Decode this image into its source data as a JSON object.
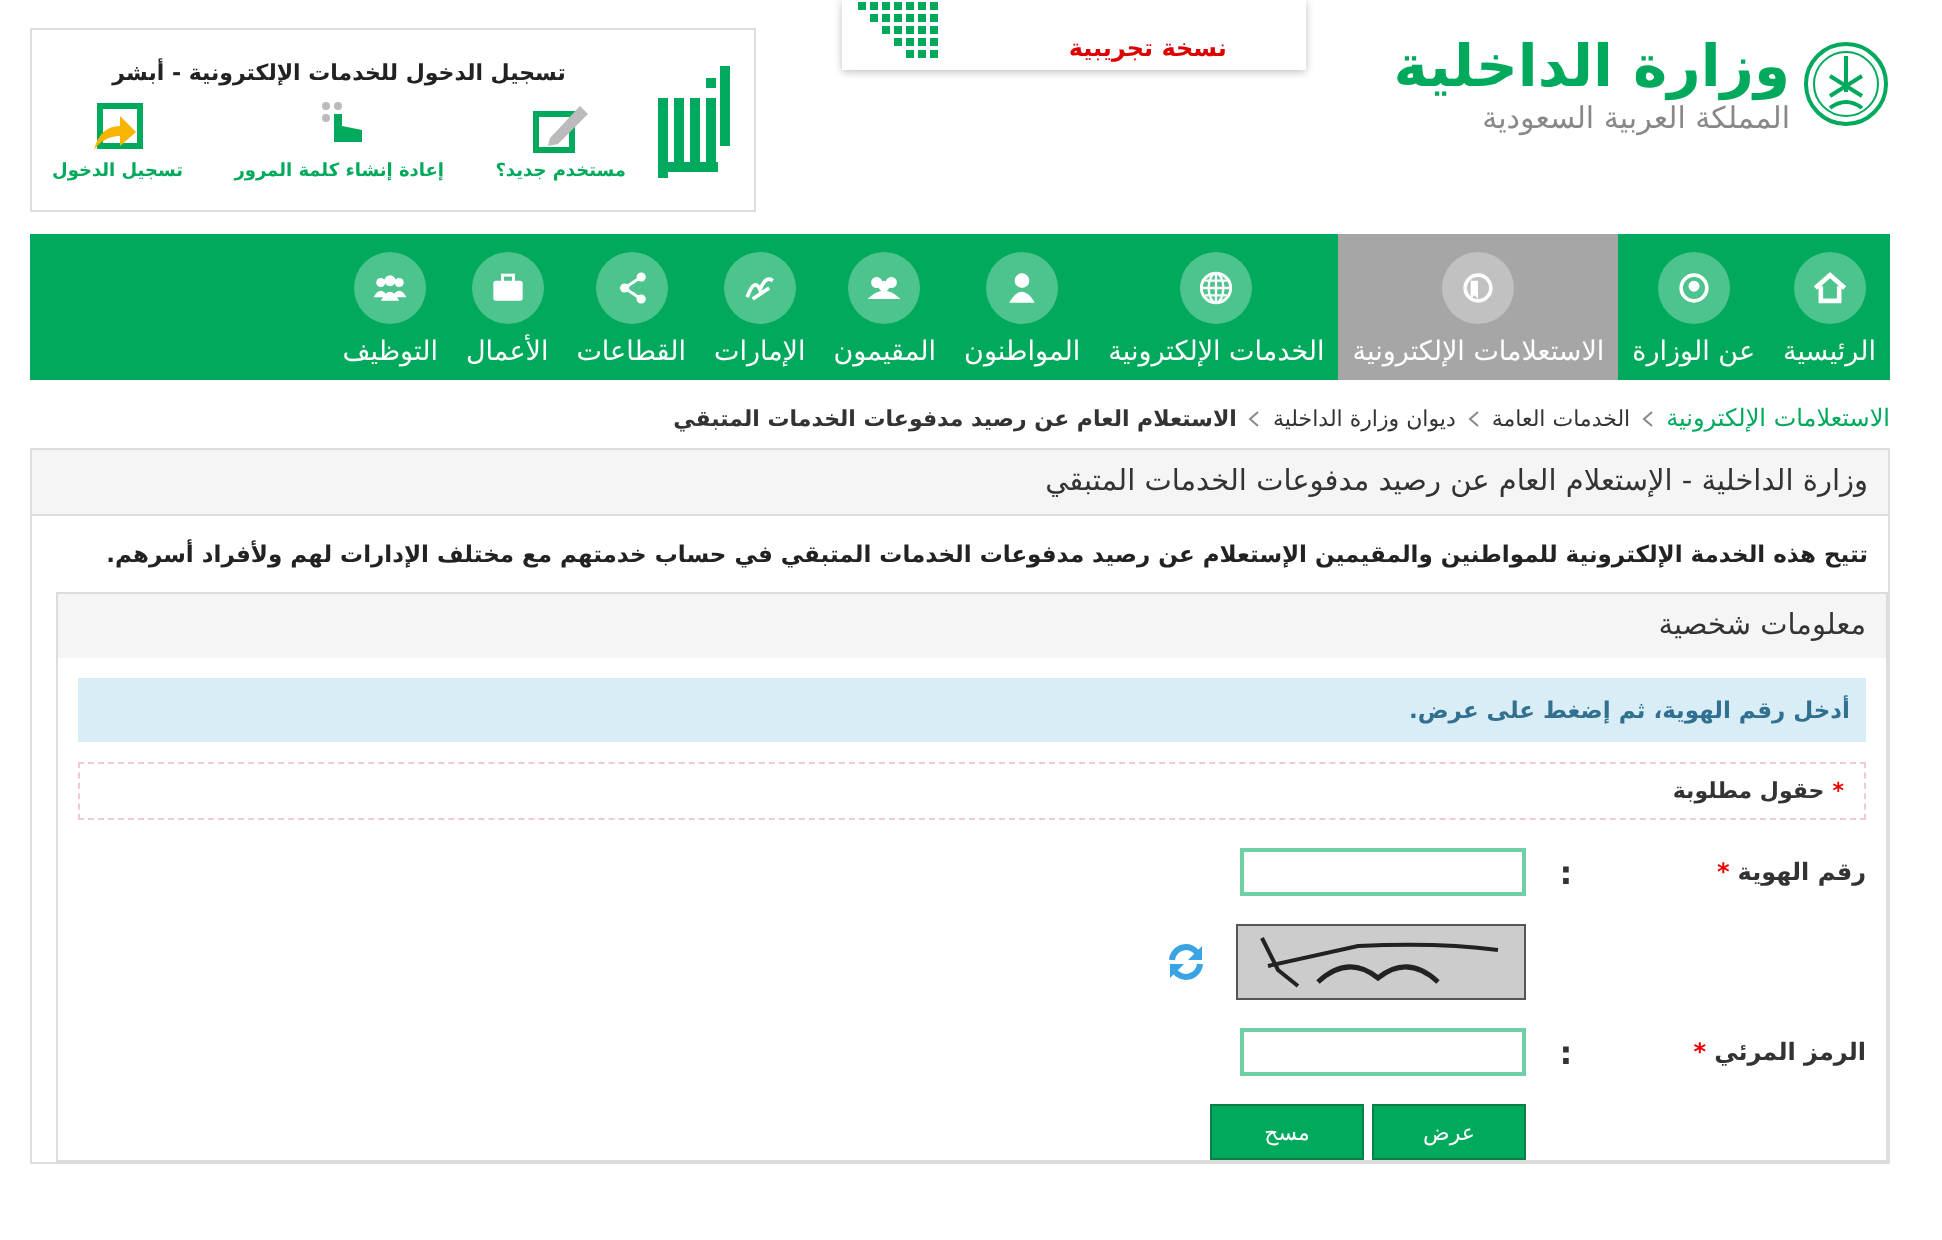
{
  "header": {
    "ministry_name": "وزارة الداخلية",
    "country_name": "المملكة العربية السعودية",
    "banner": {
      "label": "نسخة تجريبية"
    },
    "login_box": {
      "title": "تسجيل الدخول للخدمات الإلكترونية - أبشر",
      "links": [
        {
          "label": "مستخدم جديد؟"
        },
        {
          "label": "إعادة إنشاء كلمة المرور"
        },
        {
          "label": "تسجيل الدخول"
        }
      ]
    }
  },
  "nav": [
    {
      "label": "الرئيسية",
      "selected": false
    },
    {
      "label": "عن الوزارة",
      "selected": false
    },
    {
      "label": "الاستعلامات الإلكترونية",
      "selected": true
    },
    {
      "label": "الخدمات الإلكترونية",
      "selected": false
    },
    {
      "label": "المواطنون",
      "selected": false
    },
    {
      "label": "المقيمون",
      "selected": false
    },
    {
      "label": "الإمارات",
      "selected": false
    },
    {
      "label": "القطاعات",
      "selected": false
    },
    {
      "label": "الأعمال",
      "selected": false
    },
    {
      "label": "التوظيف",
      "selected": false
    }
  ],
  "breadcrumb": [
    {
      "label": "الاستعلامات الإلكترونية",
      "kind": "link"
    },
    {
      "label": "الخدمات العامة",
      "kind": "item"
    },
    {
      "label": "ديوان وزارة الداخلية",
      "kind": "item"
    },
    {
      "label": "الاستعلام العام عن رصيد مدفوعات الخدمات المتبقي",
      "kind": "current"
    }
  ],
  "panel": {
    "title": "وزارة الداخلية - الإستعلام العام عن رصيد مدفوعات الخدمات المتبقي",
    "description": "تتيح هذه الخدمة الإلكترونية للمواطنين والمقيمين الإستعلام عن رصيد مدفوعات الخدمات المتبقي في حساب خدمتهم مع مختلف الإدارات لهم ولأفراد أسرهم.",
    "section": {
      "title": "معلومات شخصية",
      "alert": "أدخل رقم الهوية، ثم إضغط على عرض.",
      "required_note": {
        "mark": "*",
        "label": "حقول مطلوبة"
      },
      "fields": [
        {
          "kind": "text",
          "label": "رقم الهوية",
          "required_mark": "*",
          "colon": ":"
        },
        {
          "kind": "captcha"
        },
        {
          "kind": "text",
          "label": "الرمز المرئي",
          "required_mark": "*",
          "colon": ":"
        }
      ],
      "buttons": [
        "عرض",
        "مسح"
      ]
    }
  }
}
